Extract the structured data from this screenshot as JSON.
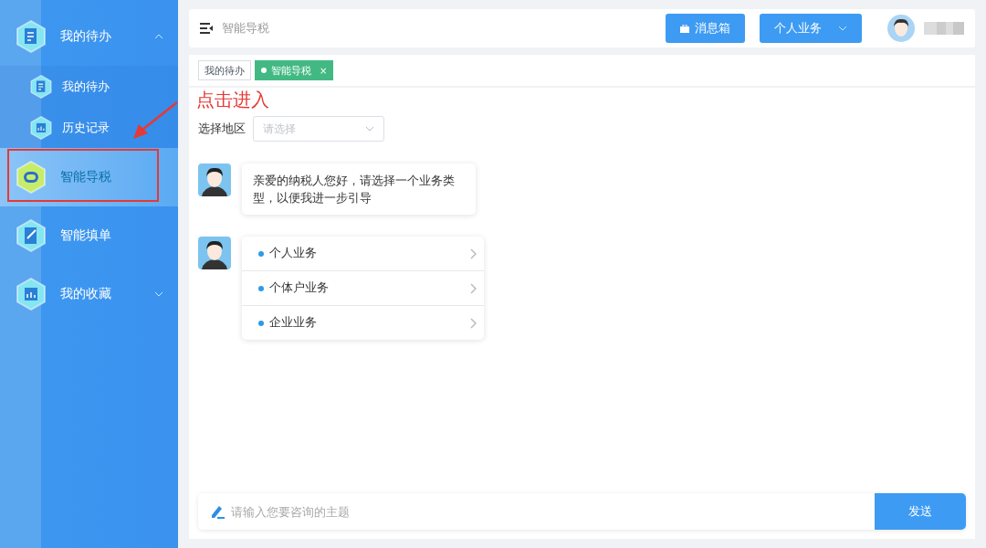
{
  "sidebar": {
    "items": [
      {
        "label": "我的待办",
        "kind": "group",
        "selected": false,
        "expanded": true,
        "children": [
          {
            "label": "我的待办",
            "selected": false
          },
          {
            "label": "历史记录",
            "selected": false
          }
        ]
      },
      {
        "label": "智能导税",
        "kind": "item",
        "selected": true
      },
      {
        "label": "智能填单",
        "kind": "item",
        "selected": false
      },
      {
        "label": "我的收藏",
        "kind": "group",
        "selected": false,
        "expanded": false
      }
    ]
  },
  "header": {
    "title": "智能导税",
    "inbox_button": "消息箱",
    "business_select": "个人业务"
  },
  "tabs": [
    {
      "label": "我的待办",
      "selected": false,
      "closable": false
    },
    {
      "label": "智能导税",
      "selected": true,
      "closable": true,
      "close": "×"
    }
  ],
  "annotation": {
    "text": "点击进入"
  },
  "region": {
    "label": "选择地区",
    "placeholder": "请选择"
  },
  "messages": [
    {
      "kind": "text",
      "text": "亲爱的纳税人您好，请选择一个业务类型，以便我进一步引导"
    },
    {
      "kind": "options",
      "options": [
        "个人业务",
        "个体户业务",
        "企业业务"
      ]
    }
  ],
  "composer": {
    "placeholder": "请输入您要咨询的主题",
    "send": "发送"
  }
}
